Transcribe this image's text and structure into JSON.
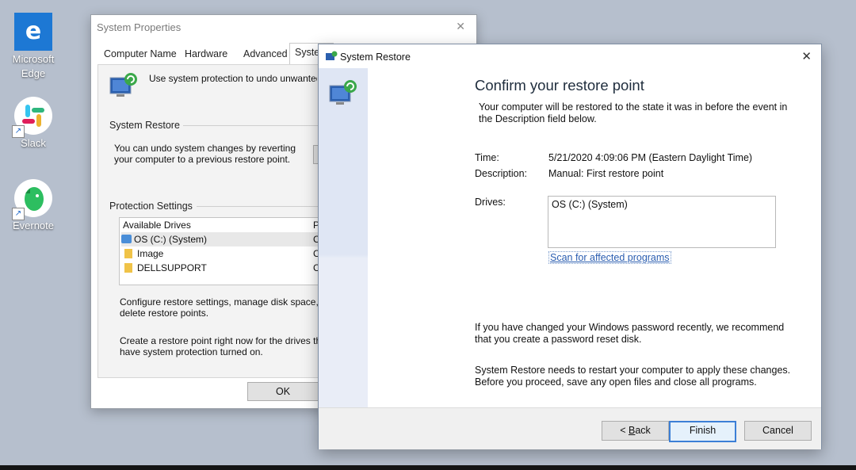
{
  "desktop": {
    "icons": [
      {
        "label_line1": "Microsoft",
        "label_line2": "Edge"
      },
      {
        "label_line1": "Slack",
        "label_line2": ""
      },
      {
        "label_line1": "Evernote",
        "label_line2": ""
      }
    ]
  },
  "system_properties": {
    "title": "System Properties",
    "tabs": [
      "Computer Name",
      "Hardware",
      "Advanced",
      "System"
    ],
    "intro": "Use system protection to undo unwanted",
    "restore_group_label": "System Restore",
    "restore_text_1": "You can undo system changes by reverting",
    "restore_text_2": "your computer to a previous restore point.",
    "protection_group_label": "Protection Settings",
    "list_header": "Available Drives",
    "list_header_col2": "P",
    "drives": [
      {
        "name": "OS (C:) (System)",
        "col2": "C"
      },
      {
        "name": "Image",
        "col2": "C"
      },
      {
        "name": "DELLSUPPORT",
        "col2": "C"
      }
    ],
    "configure_text_1": "Configure restore settings, manage disk space,",
    "configure_text_2": "delete restore points.",
    "create_text_1": "Create a restore point right now for the drives th",
    "create_text_2": "have system protection turned on.",
    "ok_label": "OK"
  },
  "system_restore": {
    "title": "System Restore",
    "heading": "Confirm your restore point",
    "intro_1": "Your computer will be restored to the state it was in before the event in",
    "intro_2": "the Description field below.",
    "time_label": "Time:",
    "time_value": "5/21/2020 4:09:06 PM (Eastern Daylight Time)",
    "description_label": "Description:",
    "description_value": "Manual: First restore point",
    "drives_label": "Drives:",
    "drives_value": "OS (C:) (System)",
    "scan_link": "Scan for affected programs",
    "password_note_1": "If you have changed your Windows password recently, we recommend",
    "password_note_2": "that you create a password reset disk.",
    "restart_note_1": "System Restore needs to restart your computer to apply these changes.",
    "restart_note_2": "Before you proceed, save any open files and close all programs.",
    "back_prefix": "< ",
    "back_access": "B",
    "back_rest": "ack",
    "finish_label": "Finish",
    "cancel_label": "Cancel"
  }
}
